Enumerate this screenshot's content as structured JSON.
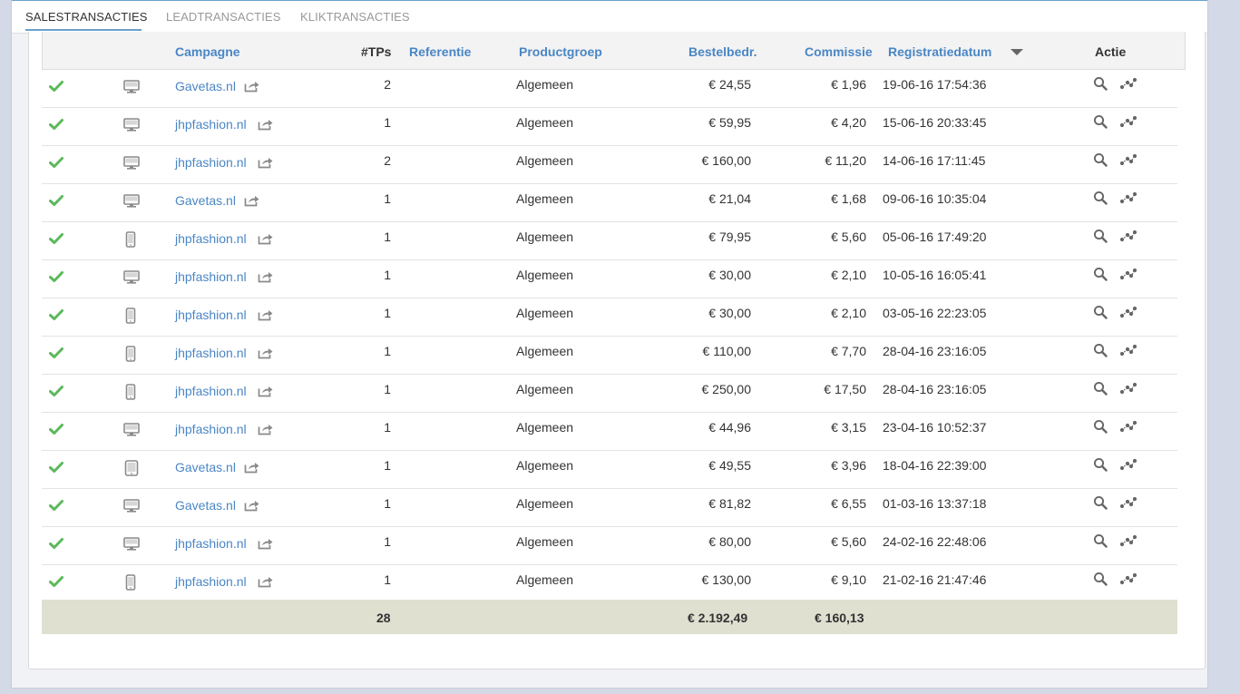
{
  "tabs": [
    {
      "label": "SALESTRANSACTIES",
      "active": true
    },
    {
      "label": "LEADTRANSACTIES",
      "active": false
    },
    {
      "label": "KLIKTRANSACTIES",
      "active": false
    }
  ],
  "table": {
    "columns": {
      "campagne": "Campagne",
      "tps": "#TPs",
      "referentie": "Referentie",
      "productgroep": "Productgroep",
      "bestelbedr": "Bestelbedr.",
      "commissie": "Commissie",
      "registratiedatum": "Registratiedatum",
      "actie": "Actie"
    },
    "sorted_by": "registratiedatum",
    "rows": [
      {
        "device": "desktop",
        "campagne": "Gavetas.nl",
        "tps": "2",
        "referentie": "",
        "productgroep": "Algemeen",
        "bestelbedr": "€ 24,55",
        "commissie": "€ 1,96",
        "datum": "19-06-16 17:54:36"
      },
      {
        "device": "desktop",
        "campagne": "jhpfashion.nl",
        "tps": "1",
        "referentie": "",
        "productgroep": "Algemeen",
        "bestelbedr": "€ 59,95",
        "commissie": "€ 4,20",
        "datum": "15-06-16 20:33:45"
      },
      {
        "device": "desktop",
        "campagne": "jhpfashion.nl",
        "tps": "2",
        "referentie": "",
        "productgroep": "Algemeen",
        "bestelbedr": "€ 160,00",
        "commissie": "€ 11,20",
        "datum": "14-06-16 17:11:45"
      },
      {
        "device": "desktop",
        "campagne": "Gavetas.nl",
        "tps": "1",
        "referentie": "",
        "productgroep": "Algemeen",
        "bestelbedr": "€ 21,04",
        "commissie": "€ 1,68",
        "datum": "09-06-16 10:35:04"
      },
      {
        "device": "mobile",
        "campagne": "jhpfashion.nl",
        "tps": "1",
        "referentie": "",
        "productgroep": "Algemeen",
        "bestelbedr": "€ 79,95",
        "commissie": "€ 5,60",
        "datum": "05-06-16 17:49:20"
      },
      {
        "device": "desktop",
        "campagne": "jhpfashion.nl",
        "tps": "1",
        "referentie": "",
        "productgroep": "Algemeen",
        "bestelbedr": "€ 30,00",
        "commissie": "€ 2,10",
        "datum": "10-05-16 16:05:41"
      },
      {
        "device": "mobile",
        "campagne": "jhpfashion.nl",
        "tps": "1",
        "referentie": "",
        "productgroep": "Algemeen",
        "bestelbedr": "€ 30,00",
        "commissie": "€ 2,10",
        "datum": "03-05-16 22:23:05"
      },
      {
        "device": "mobile",
        "campagne": "jhpfashion.nl",
        "tps": "1",
        "referentie": "",
        "productgroep": "Algemeen",
        "bestelbedr": "€ 110,00",
        "commissie": "€ 7,70",
        "datum": "28-04-16 23:16:05"
      },
      {
        "device": "mobile",
        "campagne": "jhpfashion.nl",
        "tps": "1",
        "referentie": "",
        "productgroep": "Algemeen",
        "bestelbedr": "€ 250,00",
        "commissie": "€ 17,50",
        "datum": "28-04-16 23:16:05"
      },
      {
        "device": "desktop",
        "campagne": "jhpfashion.nl",
        "tps": "1",
        "referentie": "",
        "productgroep": "Algemeen",
        "bestelbedr": "€ 44,96",
        "commissie": "€ 3,15",
        "datum": "23-04-16 10:52:37"
      },
      {
        "device": "tablet",
        "campagne": "Gavetas.nl",
        "tps": "1",
        "referentie": "",
        "productgroep": "Algemeen",
        "bestelbedr": "€ 49,55",
        "commissie": "€ 3,96",
        "datum": "18-04-16 22:39:00"
      },
      {
        "device": "desktop",
        "campagne": "Gavetas.nl",
        "tps": "1",
        "referentie": "",
        "productgroep": "Algemeen",
        "bestelbedr": "€ 81,82",
        "commissie": "€ 6,55",
        "datum": "01-03-16 13:37:18"
      },
      {
        "device": "desktop",
        "campagne": "jhpfashion.nl",
        "tps": "1",
        "referentie": "",
        "productgroep": "Algemeen",
        "bestelbedr": "€ 80,00",
        "commissie": "€ 5,60",
        "datum": "24-02-16 22:48:06"
      },
      {
        "device": "mobile",
        "campagne": "jhpfashion.nl",
        "tps": "1",
        "referentie": "",
        "productgroep": "Algemeen",
        "bestelbedr": "€ 130,00",
        "commissie": "€ 9,10",
        "datum": "21-02-16 21:47:46"
      }
    ],
    "totals": {
      "tps": "28",
      "bestelbedr": "€ 2.192,49",
      "commissie": "€ 160,13"
    }
  },
  "icons": {
    "status": "check-icon",
    "desktop": "desktop-icon",
    "mobile": "mobile-icon",
    "tablet": "tablet-icon",
    "external": "external-link-icon",
    "details": "search-icon",
    "tracking": "share-nodes-icon"
  },
  "colors": {
    "link": "#4a86c5",
    "check": "#5cb85c",
    "icon": "#8a8a8a",
    "totals_bg": "#dfe0d0",
    "accent": "#6aa0c9"
  }
}
